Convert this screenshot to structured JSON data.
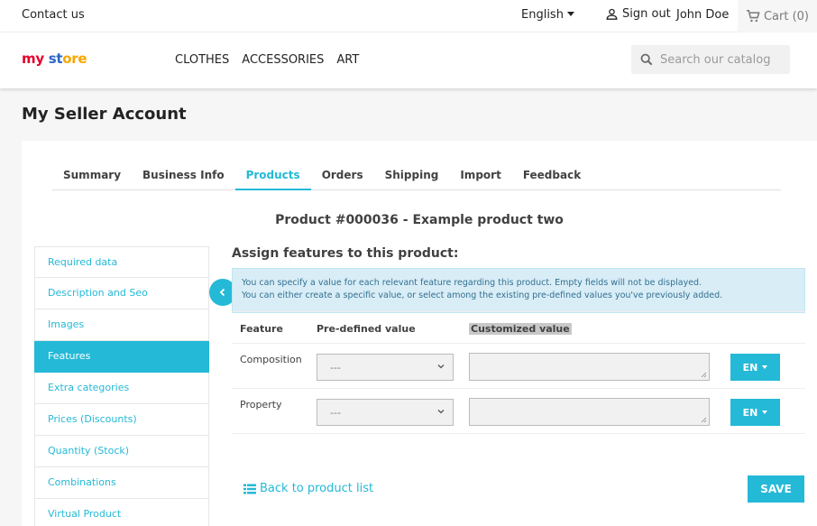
{
  "topbar": {
    "contact": "Contact us",
    "language": "English",
    "sign_out": "Sign out",
    "user_name": "John Doe",
    "cart": "Cart (0)"
  },
  "header": {
    "logo_part1": "my ",
    "logo_part2": "st",
    "logo_part3": "ore",
    "nav": [
      "CLOTHES",
      "ACCESSORIES",
      "ART"
    ],
    "search_placeholder": "Search our catalog"
  },
  "page": {
    "title": "My Seller Account"
  },
  "tabs": [
    "Summary",
    "Business Info",
    "Products",
    "Orders",
    "Shipping",
    "Import",
    "Feedback"
  ],
  "active_tab": "Products",
  "product_title": "Product #000036 - Example product two",
  "sidebar": {
    "items": [
      "Required data",
      "Description and Seo",
      "Images",
      "Features",
      "Extra categories",
      "Prices (Discounts)",
      "Quantity (Stock)",
      "Combinations",
      "Virtual Product"
    ],
    "active": "Features"
  },
  "features": {
    "section_title": "Assign features to this product:",
    "info_line1": "You can specify a value for each relevant feature regarding this product. Empty fields will not be displayed.",
    "info_line2": "You can either create a specific value, or select among the existing pre-defined values you've previously added.",
    "columns": {
      "feature": "Feature",
      "predefined": "Pre-defined value",
      "custom": "Customized value"
    },
    "rows": [
      {
        "name": "Composition",
        "selected": "---",
        "custom": "",
        "lang": "EN"
      },
      {
        "name": "Property",
        "selected": "---",
        "custom": "",
        "lang": "EN"
      }
    ],
    "back_link": "Back to product list",
    "save": "SAVE"
  },
  "colors": {
    "accent": "#24b9d7",
    "info_bg": "#d9edf7"
  }
}
